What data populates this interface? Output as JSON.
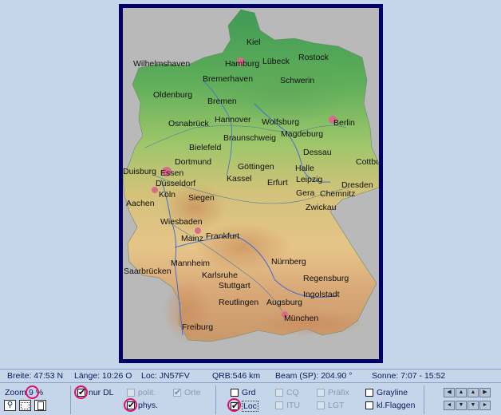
{
  "map": {
    "cities": [
      {
        "name": "Kiel",
        "l": 155,
        "t": 38
      },
      {
        "name": "Rostock",
        "l": 220,
        "t": 57
      },
      {
        "name": "Wilhelmshaven",
        "l": 13,
        "t": 65
      },
      {
        "name": "Hamburg",
        "l": 128,
        "t": 65
      },
      {
        "name": "Lübeck",
        "l": 175,
        "t": 62
      },
      {
        "name": "Bremerhaven",
        "l": 100,
        "t": 84
      },
      {
        "name": "Schwerin",
        "l": 197,
        "t": 86
      },
      {
        "name": "Oldenburg",
        "l": 38,
        "t": 104
      },
      {
        "name": "Bremen",
        "l": 106,
        "t": 112
      },
      {
        "name": "Hannover",
        "l": 115,
        "t": 135
      },
      {
        "name": "Osnabrück",
        "l": 57,
        "t": 140
      },
      {
        "name": "Wolfsburg",
        "l": 174,
        "t": 138
      },
      {
        "name": "Berlin",
        "l": 264,
        "t": 139
      },
      {
        "name": "Braunschweig",
        "l": 126,
        "t": 158
      },
      {
        "name": "Magdeburg",
        "l": 198,
        "t": 153
      },
      {
        "name": "Bielefeld",
        "l": 83,
        "t": 170
      },
      {
        "name": "Dessau",
        "l": 226,
        "t": 176
      },
      {
        "name": "Dortmund",
        "l": 65,
        "t": 188
      },
      {
        "name": "Cottbus",
        "l": 292,
        "t": 188
      },
      {
        "name": "Duisburg",
        "l": 0,
        "t": 200
      },
      {
        "name": "Essen",
        "l": 47,
        "t": 202
      },
      {
        "name": "Göttingen",
        "l": 144,
        "t": 194
      },
      {
        "name": "Halle",
        "l": 216,
        "t": 196
      },
      {
        "name": "Kassel",
        "l": 130,
        "t": 209
      },
      {
        "name": "Erfurt",
        "l": 181,
        "t": 214
      },
      {
        "name": "Leipzig",
        "l": 217,
        "t": 210
      },
      {
        "name": "Düsseldorf",
        "l": 41,
        "t": 215
      },
      {
        "name": "Dresden",
        "l": 274,
        "t": 217
      },
      {
        "name": "Köln",
        "l": 45,
        "t": 229
      },
      {
        "name": "Gera",
        "l": 217,
        "t": 227
      },
      {
        "name": "Chemnitz",
        "l": 247,
        "t": 228
      },
      {
        "name": "Siegen",
        "l": 82,
        "t": 233
      },
      {
        "name": "Aachen",
        "l": 4,
        "t": 240
      },
      {
        "name": "Zwickau",
        "l": 229,
        "t": 245
      },
      {
        "name": "Wiesbaden",
        "l": 47,
        "t": 263
      },
      {
        "name": "Frankfurt",
        "l": 104,
        "t": 281
      },
      {
        "name": "Mainz",
        "l": 73,
        "t": 284
      },
      {
        "name": "Mannheim",
        "l": 60,
        "t": 315
      },
      {
        "name": "Nürnberg",
        "l": 186,
        "t": 313
      },
      {
        "name": "Saarbrücken",
        "l": 1,
        "t": 325
      },
      {
        "name": "Karlsruhe",
        "l": 99,
        "t": 330
      },
      {
        "name": "Regensburg",
        "l": 226,
        "t": 334
      },
      {
        "name": "Stuttgart",
        "l": 120,
        "t": 343
      },
      {
        "name": "Ingolstadt",
        "l": 226,
        "t": 354
      },
      {
        "name": "Reutlingen",
        "l": 120,
        "t": 364
      },
      {
        "name": "Augsburg",
        "l": 180,
        "t": 364
      },
      {
        "name": "München",
        "l": 202,
        "t": 384
      },
      {
        "name": "Freiburg",
        "l": 74,
        "t": 395
      }
    ]
  },
  "status": {
    "breite_label": "Breite:",
    "breite_value": "47:53 N",
    "laenge_label": "Länge:",
    "laenge_value": "10:26 O",
    "loc_label": "Loc:",
    "loc_value": "JN57FV",
    "qrb_label": "QRB:",
    "qrb_value": "546 km",
    "beam_label": "Beam (SP):",
    "beam_value": "204.90 °",
    "sonne_label": "Sonne:",
    "sonne_value": "7:07 - 15:52"
  },
  "controls": {
    "zoom_label": "Zoom",
    "zoom_value": "9",
    "zoom_unit": "%",
    "nur_dl": "nur DL",
    "polit": "polit.",
    "orte": "Orte",
    "phys": "phys.",
    "grd": "Grd",
    "loc": "Loc",
    "cq": "CQ",
    "itu": "ITU",
    "praefix": "Präfix",
    "lgt": "LGT",
    "grayline": "Grayline",
    "kl_flaggen": "kl.Flaggen",
    "check_glyph": "✔"
  },
  "colors": {
    "background": "#c6d6ea",
    "frame": "#000066",
    "highlight": "#e0106b"
  }
}
